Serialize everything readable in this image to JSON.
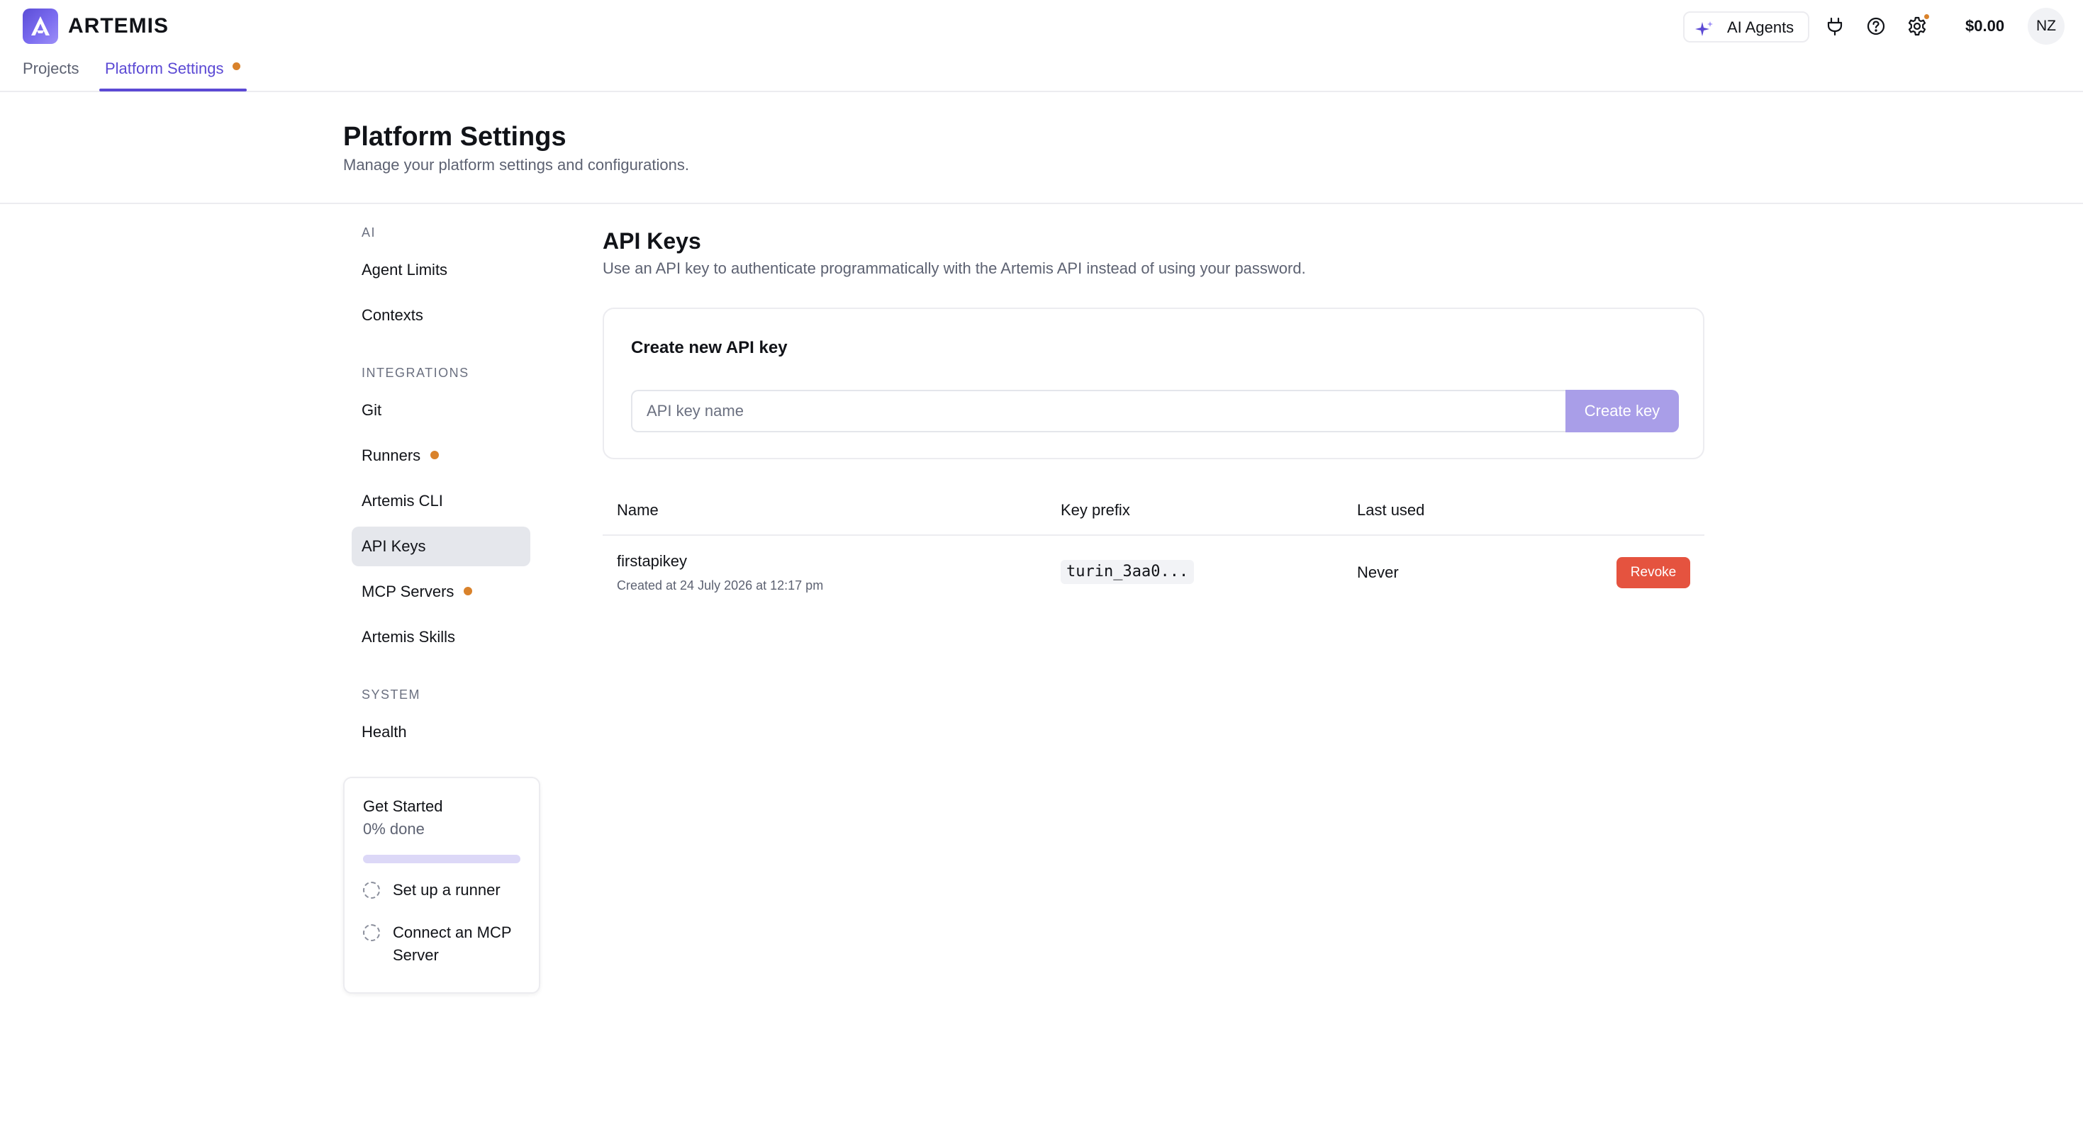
{
  "app": {
    "name": "ARTEMIS",
    "nav": {
      "projects": "Projects",
      "platform_settings": "Platform Settings"
    },
    "ai_agents": "AI Agents",
    "balance": "$0.00",
    "avatar_initials": "NZ"
  },
  "page": {
    "title": "Platform Settings",
    "subtitle": "Manage your platform settings and configurations."
  },
  "sidebar": {
    "sections": [
      {
        "title": "AI",
        "items": [
          {
            "label": "Agent Limits"
          },
          {
            "label": "Contexts"
          }
        ]
      },
      {
        "title": "INTEGRATIONS",
        "items": [
          {
            "label": "Git"
          },
          {
            "label": "Runners",
            "dot": true
          },
          {
            "label": "Artemis CLI"
          },
          {
            "label": "API Keys",
            "active": true
          },
          {
            "label": "MCP Servers",
            "dot": true
          },
          {
            "label": "Artemis Skills"
          }
        ]
      },
      {
        "title": "SYSTEM",
        "items": [
          {
            "label": "Health"
          }
        ]
      }
    ]
  },
  "get_started": {
    "title": "Get Started",
    "progress_text": "0% done",
    "progress": 0,
    "tasks": [
      {
        "label": "Set up a runner"
      },
      {
        "label": "Connect an MCP Server"
      }
    ]
  },
  "api_keys": {
    "title": "API Keys",
    "description": "Use an API key to authenticate programmatically with the Artemis API instead of using your password.",
    "create": {
      "title": "Create new API key",
      "input_placeholder": "API key name",
      "input_value": "",
      "button_label": "Create key"
    },
    "table": {
      "columns": {
        "name": "Name",
        "prefix": "Key prefix",
        "last_used": "Last used"
      },
      "rows": [
        {
          "name": "firstapikey",
          "created": "Created at 24 July 2026 at 12:17 pm",
          "prefix": "turin_3aa0...",
          "last_used": "Never",
          "action": "Revoke"
        }
      ]
    }
  },
  "colors": {
    "accent": "#5b49d4",
    "notification_dot": "#d9822b",
    "danger": "#e5533f",
    "disabled_button": "#a99ee8"
  },
  "icons": {
    "logo": "artemis-logo-icon",
    "ai_agents": "sparkle-icon",
    "integrations": "plug-icon",
    "help": "help-circle-icon",
    "settings": "gear-icon",
    "task_status": "dashed-circle-icon"
  }
}
